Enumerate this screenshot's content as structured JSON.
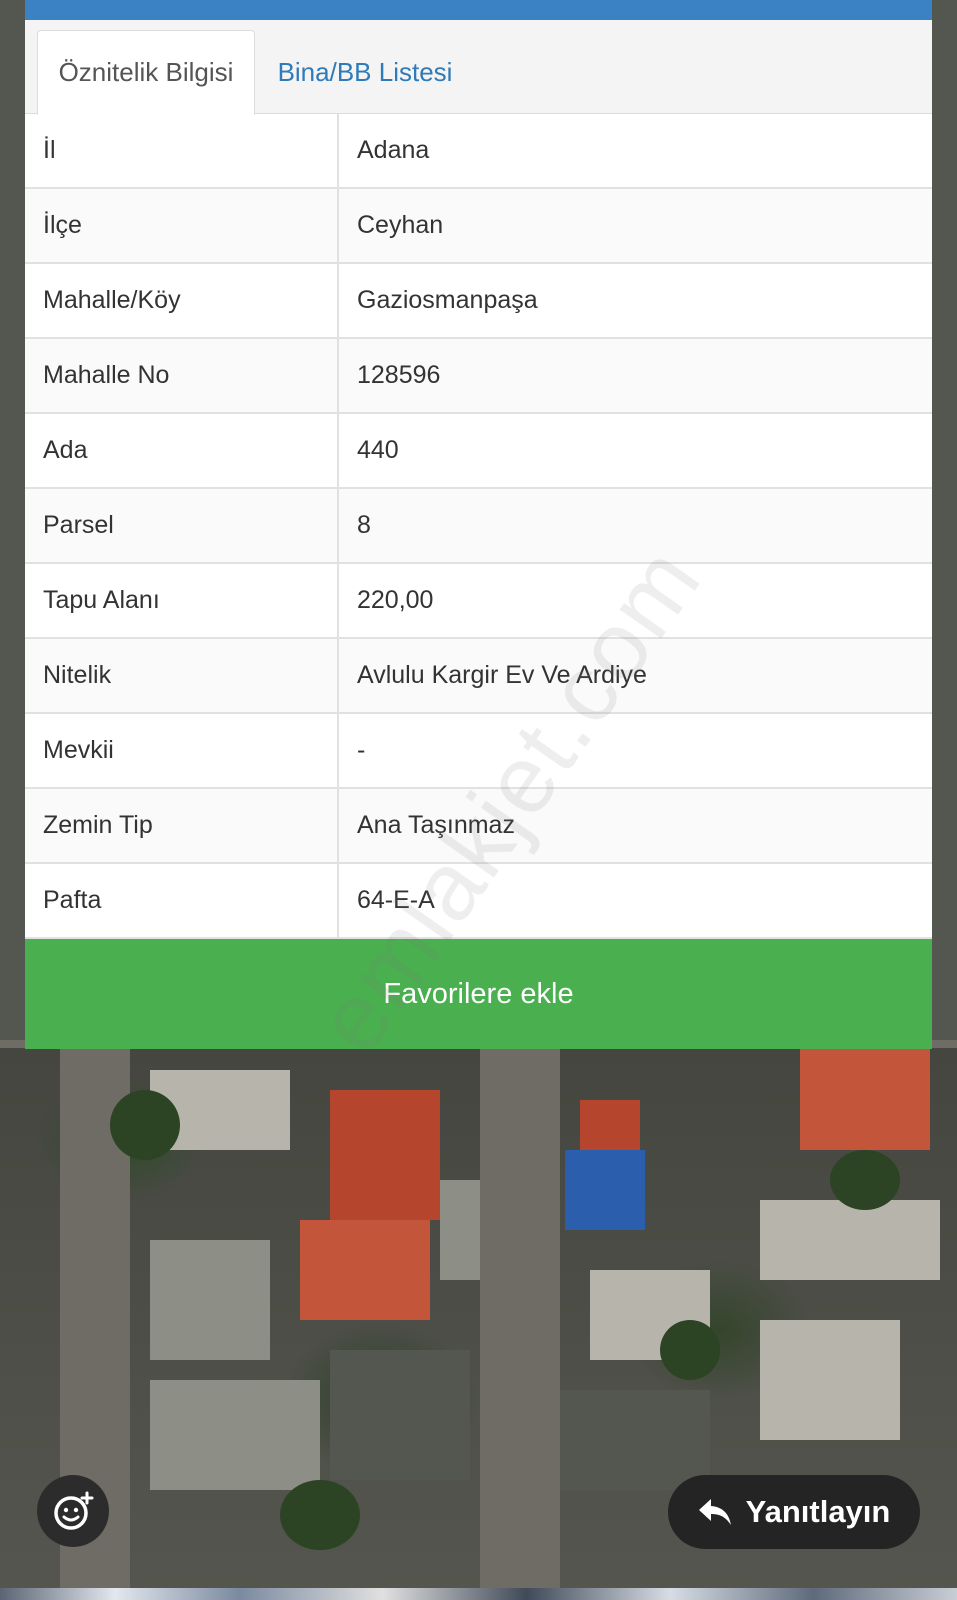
{
  "tabs": {
    "attribute_info": "Öznitelik Bilgisi",
    "building_list": "Bina/BB Listesi"
  },
  "attributes": [
    {
      "key": "İl",
      "value": "Adana"
    },
    {
      "key": "İlçe",
      "value": "Ceyhan"
    },
    {
      "key": "Mahalle/Köy",
      "value": "Gaziosmanpaşa"
    },
    {
      "key": "Mahalle No",
      "value": "128596"
    },
    {
      "key": "Ada",
      "value": "440"
    },
    {
      "key": "Parsel",
      "value": "8"
    },
    {
      "key": "Tapu Alanı",
      "value": "220,00"
    },
    {
      "key": "Nitelik",
      "value": "Avlulu Kargir Ev Ve Ardiye"
    },
    {
      "key": "Mevkii",
      "value": "-"
    },
    {
      "key": "Zemin Tip",
      "value": "Ana Taşınmaz"
    },
    {
      "key": "Pafta",
      "value": "64-E-A"
    }
  ],
  "favorite_button": "Favorilere ekle",
  "watermark": "emlakjet.com",
  "reply_button": "Yanıtlayın",
  "icons": {
    "emoji": "add-reaction-icon",
    "reply": "reply-arrow-icon"
  },
  "colors": {
    "topbar": "#3b82c4",
    "tab_link": "#2f7ab8",
    "favorite": "#4aaf4f"
  }
}
